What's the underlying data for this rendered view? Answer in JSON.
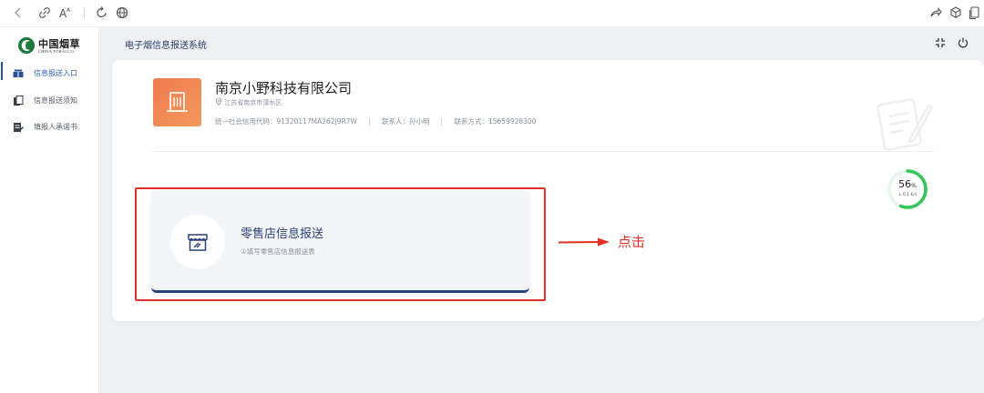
{
  "browser": {
    "icons": [
      "back-icon",
      "link-icon",
      "read-aloud-icon",
      "refresh-icon",
      "globe-icon",
      "share-icon",
      "extensions-icon",
      "collections-icon"
    ]
  },
  "sidebar": {
    "logo_cn": "中国烟草",
    "logo_en": "CHINA TOBACCO",
    "items": [
      {
        "label": "信息报送入口",
        "icon": "entry-icon",
        "active": true
      },
      {
        "label": "信息报送须知",
        "icon": "notice-icon",
        "active": false
      },
      {
        "label": "填报人承诺书",
        "icon": "pledge-icon",
        "active": false
      }
    ]
  },
  "header": {
    "title": "电子烟信息报送系统"
  },
  "company": {
    "name": "南京小野科技有限公司",
    "address": "江苏省南京市溧水区",
    "credit_code": "统一社会信用代码：91320117MA262J9R7W",
    "contact": "联系人：孙小明",
    "phone": "联系方式：15659928300"
  },
  "progress": {
    "value": 0.56,
    "percent_text": "56",
    "percent_sign": "%",
    "speed": "↓ 0.1 K/s",
    "color": "#34c759"
  },
  "task": {
    "title": "零售店信息报送",
    "subtitle": "①填写零售店信息报送表",
    "icon": "store-icon"
  },
  "annotation": {
    "label": "点击",
    "color": "#e5302a"
  }
}
